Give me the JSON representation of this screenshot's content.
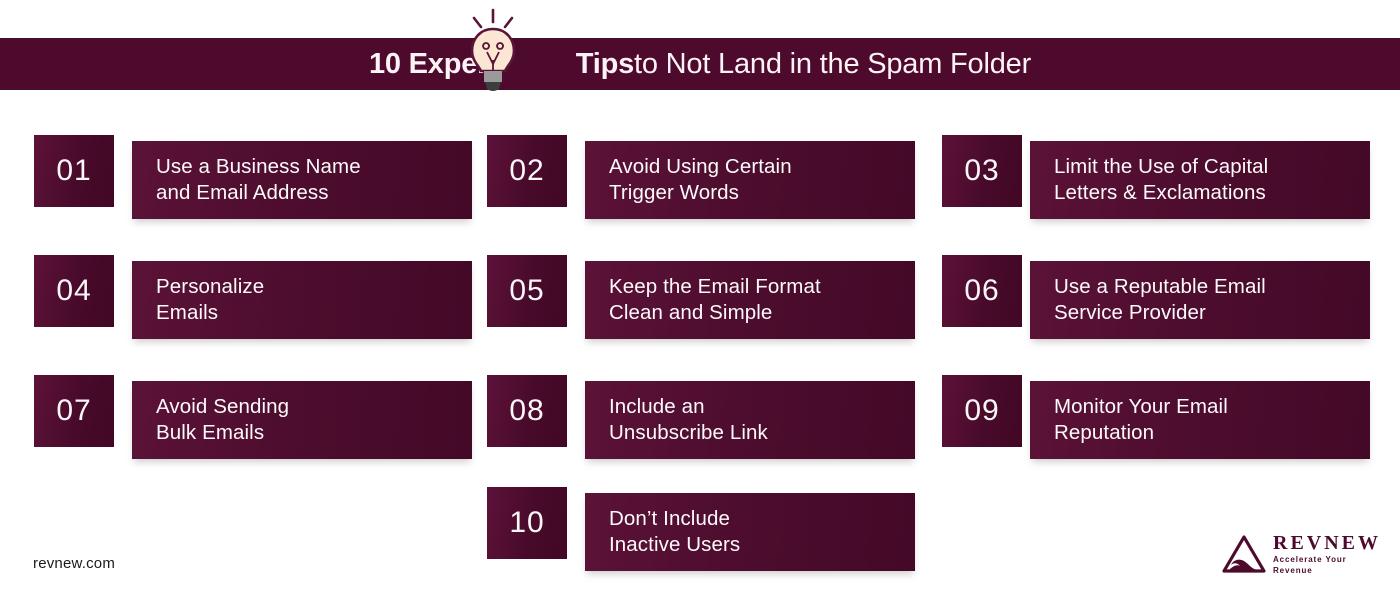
{
  "header": {
    "title_bold": "10 Expert",
    "title_mid": "Tips",
    "title_rest": " to Not Land in the Spam Folder",
    "icon": "lightbulb-icon",
    "bar_color": "#4d0a2c",
    "text_color": "#fdf2f6"
  },
  "tips": [
    {
      "number": "01",
      "text": "Use a Business Name\nand Email Address"
    },
    {
      "number": "02",
      "text": "Avoid Using Certain\nTrigger Words"
    },
    {
      "number": "03",
      "text": "Limit the Use of Capital\nLetters & Exclamations"
    },
    {
      "number": "04",
      "text": "Personalize\nEmails"
    },
    {
      "number": "05",
      "text": "Keep the Email Format\nClean and Simple"
    },
    {
      "number": "06",
      "text": "Use a Reputable Email\nService Provider"
    },
    {
      "number": "07",
      "text": "Avoid Sending\nBulk Emails"
    },
    {
      "number": "08",
      "text": "Include an\nUnsubscribe Link"
    },
    {
      "number": "09",
      "text": "Monitor Your Email\nReputation"
    },
    {
      "number": "10",
      "text": "Don’t Include\nInactive Users"
    }
  ],
  "footer": {
    "site_url": "revnew.com",
    "logo_name": "REVNEW",
    "logo_tagline": "Accelerate Your Revenue",
    "logo_color": "#4d0a2c"
  }
}
